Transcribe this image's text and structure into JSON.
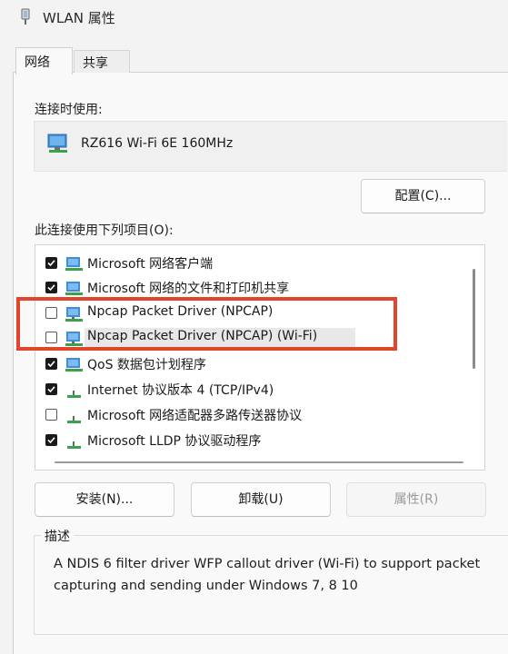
{
  "window": {
    "title": "WLAN 属性"
  },
  "tabs": [
    {
      "label": "网络",
      "active": true
    },
    {
      "label": "共享",
      "active": false
    }
  ],
  "connect_using": {
    "label": "连接时使用:",
    "adapter": "RZ616 Wi-Fi 6E 160MHz",
    "configure_button": "配置(C)..."
  },
  "items_section": {
    "label": "此连接使用下列项目(O):",
    "items": [
      {
        "label": "Microsoft 网络客户端",
        "checked": true,
        "icon": "network-client-icon"
      },
      {
        "label": "Microsoft 网络的文件和打印机共享",
        "checked": true,
        "icon": "file-printer-sharing-icon"
      },
      {
        "label": "Npcap Packet Driver (NPCAP)",
        "checked": false,
        "icon": "npcap-driver-icon"
      },
      {
        "label": "Npcap Packet Driver (NPCAP) (Wi-Fi)",
        "checked": false,
        "icon": "npcap-driver-icon",
        "selected": true
      },
      {
        "label": "QoS 数据包计划程序",
        "checked": true,
        "icon": "qos-scheduler-icon"
      },
      {
        "label": "Internet 协议版本 4 (TCP/IPv4)",
        "checked": true,
        "icon": "protocol-icon"
      },
      {
        "label": "Microsoft 网络适配器多路传送器协议",
        "checked": false,
        "icon": "protocol-icon"
      },
      {
        "label": "Microsoft LLDP 协议驱动程序",
        "checked": true,
        "icon": "protocol-icon"
      }
    ]
  },
  "buttons": {
    "install": "安装(N)...",
    "uninstall": "卸载(U)",
    "properties": "属性(R)"
  },
  "description": {
    "label": "描述",
    "text": "A NDIS 6 filter driver  WFP callout driver (Wi-Fi) to support packet capturing and sending under Windows 7, 8  10"
  },
  "colors": {
    "highlight_box": "#e2452e",
    "checkbox_checked": "#1a1a1a"
  }
}
